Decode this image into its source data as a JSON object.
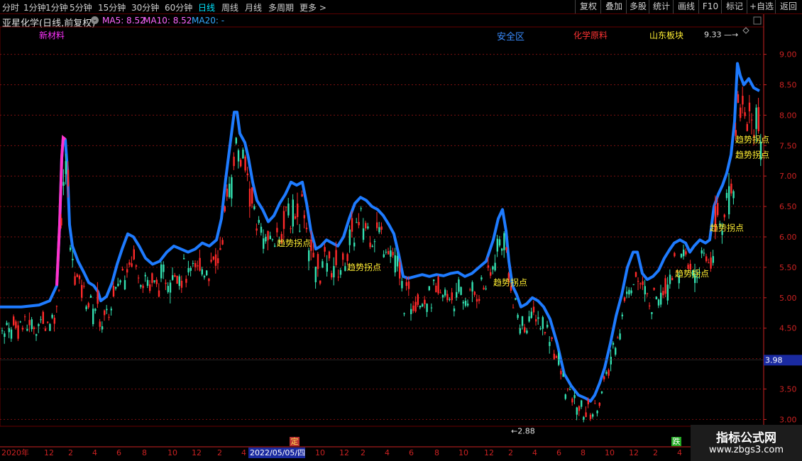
{
  "toolbar": {
    "timeframes": [
      "分时",
      "1分钟",
      "5分钟",
      "15分钟",
      "30分钟",
      "60分钟",
      "日线",
      "周线",
      "月线",
      "多周期",
      "更多 >"
    ],
    "active_timeframe": "日线",
    "right_buttons": [
      "复权",
      "叠加",
      "多股",
      "统计",
      "画线",
      "F10",
      "标记",
      "+自选",
      "返回"
    ]
  },
  "info": {
    "symbol": "亚星化学(日线,前复权)",
    "dropdown_glyph": "⌄",
    "ma5_label": "MA5: 8.52",
    "ma10_label": "MA10: 8.52",
    "ma20_label": "MA20: -"
  },
  "tags": {
    "t1": "新材料",
    "t2": "安全区",
    "t3": "化学原料",
    "t4": "山东板块"
  },
  "colors": {
    "up": "#ff2a2a",
    "down": "#33e0b0",
    "band": "#1e7bff",
    "band_alt": "#ff33cc",
    "trend_label": "#ffee33",
    "axis_red": "#cc2222"
  },
  "chart_data": {
    "type": "candlestick",
    "ylim": [
      2.9,
      9.45
    ],
    "y_ticks": [
      "3.00",
      "3.50",
      "4.00",
      "4.50",
      "5.00",
      "5.50",
      "6.00",
      "6.50",
      "7.00",
      "7.50",
      "8.00",
      "8.50",
      "9.00"
    ],
    "current_price_label": "3.98",
    "x_ticks": [
      "2020年",
      "12",
      "2",
      "4",
      "6",
      "8",
      "10",
      "12",
      "2",
      "4",
      "2022/05/05/四",
      "10",
      "12",
      "2",
      "4",
      "6",
      "8",
      "10",
      "12",
      "2",
      "4",
      "6",
      "8",
      "10",
      "12",
      "2",
      "4",
      "6"
    ],
    "max_label": "9.33",
    "min_label": "2.88",
    "signal_text": "趋势拐点",
    "markers": [
      "定",
      "跌"
    ],
    "band_points": [
      [
        0,
        4.85
      ],
      [
        30,
        4.85
      ],
      [
        55,
        4.88
      ],
      [
        70,
        4.95
      ],
      [
        80,
        5.2
      ],
      [
        84,
        6.2
      ],
      [
        87,
        7.3
      ],
      [
        89,
        7.63
      ],
      [
        92,
        7.6
      ],
      [
        95,
        7.1
      ],
      [
        98,
        6.2
      ],
      [
        102,
        5.85
      ],
      [
        110,
        5.6
      ],
      [
        118,
        5.42
      ],
      [
        125,
        5.25
      ],
      [
        132,
        5.2
      ],
      [
        138,
        5.1
      ],
      [
        142,
        4.95
      ],
      [
        150,
        5.02
      ],
      [
        158,
        5.25
      ],
      [
        165,
        5.55
      ],
      [
        172,
        5.8
      ],
      [
        180,
        6.05
      ],
      [
        188,
        6.0
      ],
      [
        196,
        5.85
      ],
      [
        205,
        5.65
      ],
      [
        215,
        5.55
      ],
      [
        225,
        5.6
      ],
      [
        235,
        5.75
      ],
      [
        245,
        5.85
      ],
      [
        255,
        5.8
      ],
      [
        265,
        5.75
      ],
      [
        275,
        5.8
      ],
      [
        285,
        5.9
      ],
      [
        295,
        5.85
      ],
      [
        305,
        5.95
      ],
      [
        312,
        6.3
      ],
      [
        318,
        6.95
      ],
      [
        324,
        7.5
      ],
      [
        330,
        8.05
      ],
      [
        334,
        8.05
      ],
      [
        338,
        7.7
      ],
      [
        345,
        7.55
      ],
      [
        350,
        7.3
      ],
      [
        356,
        6.9
      ],
      [
        362,
        6.6
      ],
      [
        370,
        6.45
      ],
      [
        378,
        6.25
      ],
      [
        386,
        6.35
      ],
      [
        394,
        6.55
      ],
      [
        402,
        6.7
      ],
      [
        410,
        6.9
      ],
      [
        418,
        6.85
      ],
      [
        426,
        6.9
      ],
      [
        432,
        6.55
      ],
      [
        438,
        6.1
      ],
      [
        445,
        5.8
      ],
      [
        452,
        5.85
      ],
      [
        460,
        5.95
      ],
      [
        468,
        5.9
      ],
      [
        476,
        5.85
      ],
      [
        484,
        6.0
      ],
      [
        492,
        6.3
      ],
      [
        500,
        6.55
      ],
      [
        508,
        6.65
      ],
      [
        516,
        6.6
      ],
      [
        524,
        6.5
      ],
      [
        532,
        6.45
      ],
      [
        540,
        6.35
      ],
      [
        548,
        6.2
      ],
      [
        555,
        6.05
      ],
      [
        562,
        5.7
      ],
      [
        568,
        5.35
      ],
      [
        575,
        5.32
      ],
      [
        585,
        5.35
      ],
      [
        595,
        5.38
      ],
      [
        605,
        5.35
      ],
      [
        615,
        5.38
      ],
      [
        625,
        5.36
      ],
      [
        635,
        5.4
      ],
      [
        645,
        5.42
      ],
      [
        655,
        5.35
      ],
      [
        665,
        5.4
      ],
      [
        675,
        5.5
      ],
      [
        685,
        5.6
      ],
      [
        695,
        5.95
      ],
      [
        702,
        6.3
      ],
      [
        708,
        6.45
      ],
      [
        713,
        6.1
      ],
      [
        717,
        5.6
      ],
      [
        722,
        5.2
      ],
      [
        728,
        5.05
      ],
      [
        734,
        4.85
      ],
      [
        742,
        4.9
      ],
      [
        750,
        5.0
      ],
      [
        758,
        4.95
      ],
      [
        766,
        4.85
      ],
      [
        775,
        4.65
      ],
      [
        785,
        4.25
      ],
      [
        795,
        3.75
      ],
      [
        805,
        3.55
      ],
      [
        815,
        3.4
      ],
      [
        825,
        3.35
      ],
      [
        832,
        3.3
      ],
      [
        838,
        3.4
      ],
      [
        845,
        3.6
      ],
      [
        852,
        3.85
      ],
      [
        860,
        4.25
      ],
      [
        868,
        4.7
      ],
      [
        876,
        5.05
      ],
      [
        884,
        5.5
      ],
      [
        892,
        5.75
      ],
      [
        898,
        5.75
      ],
      [
        905,
        5.4
      ],
      [
        912,
        5.3
      ],
      [
        920,
        5.35
      ],
      [
        928,
        5.45
      ],
      [
        936,
        5.65
      ],
      [
        944,
        5.8
      ],
      [
        950,
        5.9
      ],
      [
        958,
        5.95
      ],
      [
        966,
        5.9
      ],
      [
        972,
        5.75
      ],
      [
        978,
        5.85
      ],
      [
        986,
        5.95
      ],
      [
        994,
        5.9
      ],
      [
        1000,
        5.95
      ],
      [
        1006,
        6.5
      ],
      [
        1012,
        6.7
      ],
      [
        1018,
        6.85
      ],
      [
        1024,
        7.05
      ],
      [
        1030,
        7.35
      ],
      [
        1035,
        7.9
      ],
      [
        1039,
        8.85
      ],
      [
        1043,
        8.65
      ],
      [
        1048,
        8.5
      ],
      [
        1055,
        8.6
      ],
      [
        1062,
        8.45
      ],
      [
        1070,
        8.4
      ]
    ],
    "signal_positions": [
      [
        390,
        5.85
      ],
      [
        489,
        5.45
      ],
      [
        695,
        5.2
      ],
      [
        1000,
        6.1
      ],
      [
        951,
        5.35
      ],
      [
        1036,
        7.55
      ],
      [
        1036,
        7.3
      ]
    ]
  },
  "watermark": {
    "line1": "指标公式网",
    "line2": "www.zbgs3.com"
  }
}
